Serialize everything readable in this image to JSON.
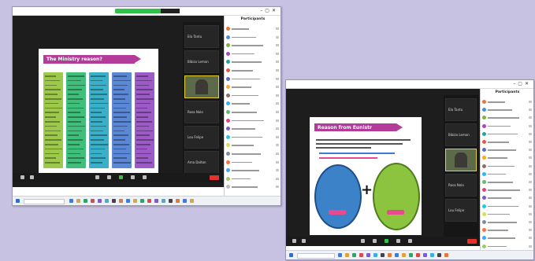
{
  "screenshot_left": {
    "slide_title": "The Ministry reason?",
    "participants_header": "Participants",
    "thumbnails": [
      "Ela Tantu",
      "Bibizo Lemon",
      "",
      "Rosa Nolo",
      "Lou Felipe",
      "Ama Dalton"
    ],
    "column_colors": [
      "#9cc94a",
      "#3fbf7a",
      "#3ab0c8",
      "#5b88d6",
      "#9c5bc7"
    ],
    "avatar_colors": [
      "#e8743b",
      "#4a90d9",
      "#7cb342",
      "#ab47bc",
      "#26a69a",
      "#ef5350",
      "#5c6bc0",
      "#ffa726",
      "#8d6e63",
      "#29b6f6",
      "#66bb6a",
      "#ec407a",
      "#7e57c2",
      "#26c6da",
      "#d4e157",
      "#78909c",
      "#ff7043",
      "#42a5f5",
      "#9ccc65",
      "#bdbdbd"
    ]
  },
  "screenshot_right": {
    "slide_title": "Reason from Eunistr",
    "participants_header": "Participants",
    "thumbnails": [
      "Ela Tantu",
      "Bibizo Lemon",
      "",
      "Rosa Nolo",
      "Lou Felipe"
    ],
    "oval_colors": [
      "#3b82c8",
      "#8cc43f"
    ],
    "avatar_colors": [
      "#e8743b",
      "#4a90d9",
      "#7cb342",
      "#ab47bc",
      "#26a69a",
      "#ef5350",
      "#5c6bc0",
      "#ffa726",
      "#8d6e63",
      "#29b6f6",
      "#66bb6a",
      "#ec407a",
      "#7e57c2",
      "#26c6da",
      "#d4e157",
      "#78909c",
      "#ff7043",
      "#42a5f5",
      "#9ccc65"
    ]
  },
  "icons": {
    "end_button": "end-meeting-icon",
    "mic": "mic-icon",
    "video": "video-icon",
    "share": "share-screen-icon",
    "start": "windows-start-icon"
  }
}
